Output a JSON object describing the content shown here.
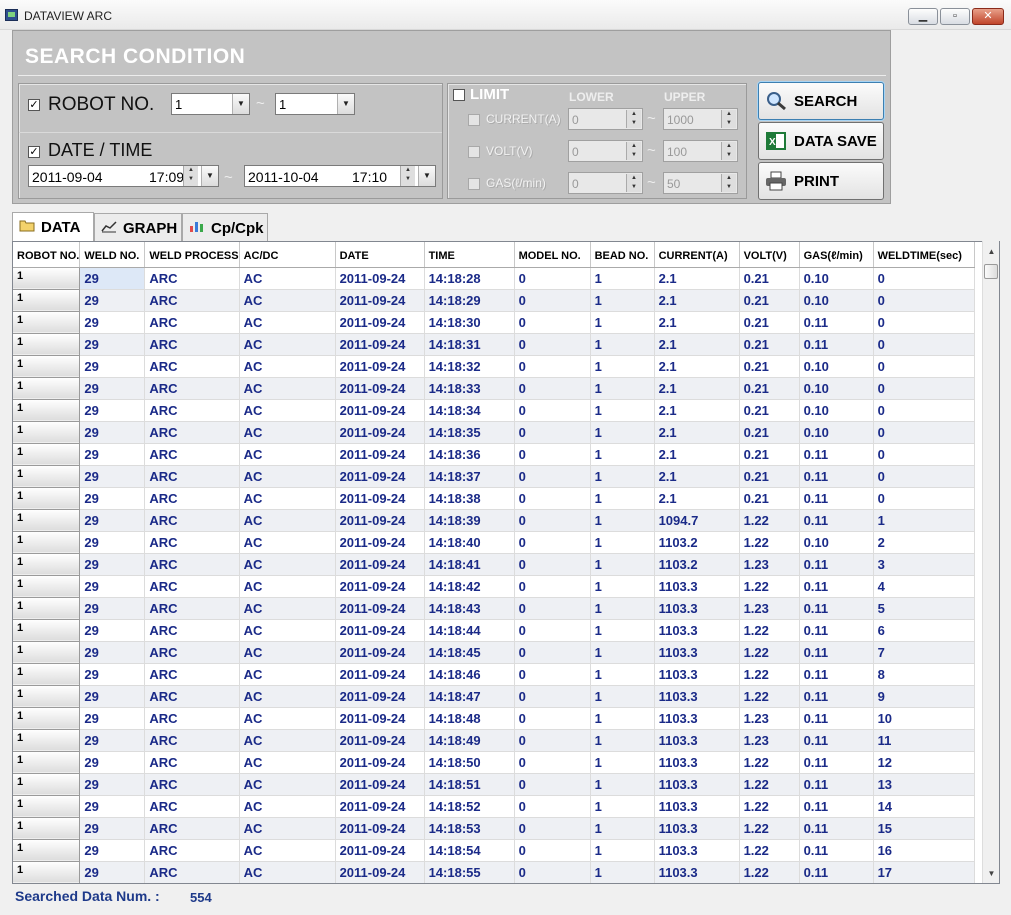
{
  "window": {
    "title": "DATAVIEW ARC",
    "minimize": "▁",
    "maximize": "▫",
    "close": "✕"
  },
  "search": {
    "title": "SEARCH CONDITION",
    "robot_no": {
      "label": "ROBOT NO.",
      "checked": true,
      "from": "1",
      "to": "1",
      "tilde": "~"
    },
    "date_time": {
      "label": "DATE / TIME",
      "checked": true,
      "from_date": "2011-09-04",
      "from_time": "17:09",
      "to_date": "2011-10-04",
      "to_time": "17:10",
      "tilde": "~"
    },
    "limit": {
      "label": "LIMIT",
      "checked": false,
      "lower_header": "LOWER",
      "upper_header": "UPPER",
      "tilde": "~",
      "rows": [
        {
          "label": "CURRENT(A)",
          "lower": "0",
          "upper": "1000"
        },
        {
          "label": "VOLT(V)",
          "lower": "0",
          "upper": "100"
        },
        {
          "label": "GAS(ℓ/min)",
          "lower": "0",
          "upper": "50"
        }
      ]
    },
    "buttons": {
      "search": "SEARCH",
      "data_save": "DATA SAVE",
      "print": "PRINT"
    }
  },
  "tabs": [
    {
      "label": "DATA",
      "active": true
    },
    {
      "label": "GRAPH",
      "active": false
    },
    {
      "label": "Cp/Cpk",
      "active": false
    }
  ],
  "table": {
    "columns": [
      "ROBOT NO.",
      "WELD NO.",
      "WELD PROCESS",
      "AC/DC",
      "DATE",
      "TIME",
      "MODEL NO.",
      "BEAD NO.",
      "CURRENT(A)",
      "VOLT(V)",
      "GAS(ℓ/min)",
      "WELDTIME(sec)"
    ],
    "rows": [
      [
        "1",
        "29",
        "ARC",
        "AC",
        "2011-09-24",
        "14:18:28",
        "0",
        "1",
        "2.1",
        "0.21",
        "0.10",
        "0"
      ],
      [
        "1",
        "29",
        "ARC",
        "AC",
        "2011-09-24",
        "14:18:29",
        "0",
        "1",
        "2.1",
        "0.21",
        "0.10",
        "0"
      ],
      [
        "1",
        "29",
        "ARC",
        "AC",
        "2011-09-24",
        "14:18:30",
        "0",
        "1",
        "2.1",
        "0.21",
        "0.11",
        "0"
      ],
      [
        "1",
        "29",
        "ARC",
        "AC",
        "2011-09-24",
        "14:18:31",
        "0",
        "1",
        "2.1",
        "0.21",
        "0.11",
        "0"
      ],
      [
        "1",
        "29",
        "ARC",
        "AC",
        "2011-09-24",
        "14:18:32",
        "0",
        "1",
        "2.1",
        "0.21",
        "0.10",
        "0"
      ],
      [
        "1",
        "29",
        "ARC",
        "AC",
        "2011-09-24",
        "14:18:33",
        "0",
        "1",
        "2.1",
        "0.21",
        "0.10",
        "0"
      ],
      [
        "1",
        "29",
        "ARC",
        "AC",
        "2011-09-24",
        "14:18:34",
        "0",
        "1",
        "2.1",
        "0.21",
        "0.10",
        "0"
      ],
      [
        "1",
        "29",
        "ARC",
        "AC",
        "2011-09-24",
        "14:18:35",
        "0",
        "1",
        "2.1",
        "0.21",
        "0.10",
        "0"
      ],
      [
        "1",
        "29",
        "ARC",
        "AC",
        "2011-09-24",
        "14:18:36",
        "0",
        "1",
        "2.1",
        "0.21",
        "0.11",
        "0"
      ],
      [
        "1",
        "29",
        "ARC",
        "AC",
        "2011-09-24",
        "14:18:37",
        "0",
        "1",
        "2.1",
        "0.21",
        "0.11",
        "0"
      ],
      [
        "1",
        "29",
        "ARC",
        "AC",
        "2011-09-24",
        "14:18:38",
        "0",
        "1",
        "2.1",
        "0.21",
        "0.11",
        "0"
      ],
      [
        "1",
        "29",
        "ARC",
        "AC",
        "2011-09-24",
        "14:18:39",
        "0",
        "1",
        "1094.7",
        "1.22",
        "0.11",
        "1"
      ],
      [
        "1",
        "29",
        "ARC",
        "AC",
        "2011-09-24",
        "14:18:40",
        "0",
        "1",
        "1103.2",
        "1.22",
        "0.10",
        "2"
      ],
      [
        "1",
        "29",
        "ARC",
        "AC",
        "2011-09-24",
        "14:18:41",
        "0",
        "1",
        "1103.2",
        "1.23",
        "0.11",
        "3"
      ],
      [
        "1",
        "29",
        "ARC",
        "AC",
        "2011-09-24",
        "14:18:42",
        "0",
        "1",
        "1103.3",
        "1.22",
        "0.11",
        "4"
      ],
      [
        "1",
        "29",
        "ARC",
        "AC",
        "2011-09-24",
        "14:18:43",
        "0",
        "1",
        "1103.3",
        "1.23",
        "0.11",
        "5"
      ],
      [
        "1",
        "29",
        "ARC",
        "AC",
        "2011-09-24",
        "14:18:44",
        "0",
        "1",
        "1103.3",
        "1.22",
        "0.11",
        "6"
      ],
      [
        "1",
        "29",
        "ARC",
        "AC",
        "2011-09-24",
        "14:18:45",
        "0",
        "1",
        "1103.3",
        "1.22",
        "0.11",
        "7"
      ],
      [
        "1",
        "29",
        "ARC",
        "AC",
        "2011-09-24",
        "14:18:46",
        "0",
        "1",
        "1103.3",
        "1.22",
        "0.11",
        "8"
      ],
      [
        "1",
        "29",
        "ARC",
        "AC",
        "2011-09-24",
        "14:18:47",
        "0",
        "1",
        "1103.3",
        "1.22",
        "0.11",
        "9"
      ],
      [
        "1",
        "29",
        "ARC",
        "AC",
        "2011-09-24",
        "14:18:48",
        "0",
        "1",
        "1103.3",
        "1.23",
        "0.11",
        "10"
      ],
      [
        "1",
        "29",
        "ARC",
        "AC",
        "2011-09-24",
        "14:18:49",
        "0",
        "1",
        "1103.3",
        "1.23",
        "0.11",
        "11"
      ],
      [
        "1",
        "29",
        "ARC",
        "AC",
        "2011-09-24",
        "14:18:50",
        "0",
        "1",
        "1103.3",
        "1.22",
        "0.11",
        "12"
      ],
      [
        "1",
        "29",
        "ARC",
        "AC",
        "2011-09-24",
        "14:18:51",
        "0",
        "1",
        "1103.3",
        "1.22",
        "0.11",
        "13"
      ],
      [
        "1",
        "29",
        "ARC",
        "AC",
        "2011-09-24",
        "14:18:52",
        "0",
        "1",
        "1103.3",
        "1.22",
        "0.11",
        "14"
      ],
      [
        "1",
        "29",
        "ARC",
        "AC",
        "2011-09-24",
        "14:18:53",
        "0",
        "1",
        "1103.3",
        "1.22",
        "0.11",
        "15"
      ],
      [
        "1",
        "29",
        "ARC",
        "AC",
        "2011-09-24",
        "14:18:54",
        "0",
        "1",
        "1103.3",
        "1.22",
        "0.11",
        "16"
      ],
      [
        "1",
        "29",
        "ARC",
        "AC",
        "2011-09-24",
        "14:18:55",
        "0",
        "1",
        "1103.3",
        "1.22",
        "0.11",
        "17"
      ]
    ]
  },
  "status": {
    "label": "Searched Data Num. :",
    "value": "554"
  },
  "colors": {
    "search_panel": "#c3c3c3",
    "cell_text": "#1a2a88",
    "status_text": "#1e3a8a"
  },
  "icons": {
    "app": "app-icon",
    "search": "magnifier-icon",
    "save": "excel-icon",
    "print": "printer-icon",
    "data_tab": "folder-icon",
    "graph_tab": "graph-icon",
    "cp_tab": "bar-chart-icon"
  }
}
